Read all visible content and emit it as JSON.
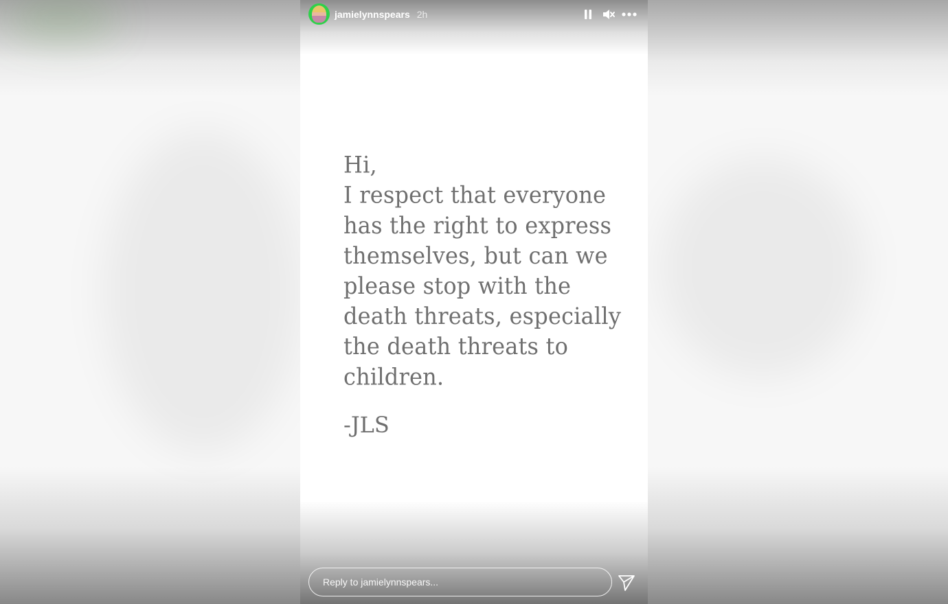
{
  "story": {
    "username": "jamielynnspears",
    "timestamp": "2h",
    "message": "Hi,\nI respect that everyone\nhas the right to express\nthemselves, but can we\nplease stop with the\ndeath threats, especially\nthe death threats to\nchildren.",
    "signature": "-JLS"
  },
  "controls": {
    "pause_icon": "pause-icon",
    "mute_icon": "muted-speaker-icon",
    "more_icon": "more-options-icon"
  },
  "reply": {
    "placeholder": "Reply to jamielynnspears..."
  },
  "colors": {
    "avatar_ring": "#2fd14a",
    "message_text": "#6f6f6f",
    "panel_background": "#ffffff"
  }
}
